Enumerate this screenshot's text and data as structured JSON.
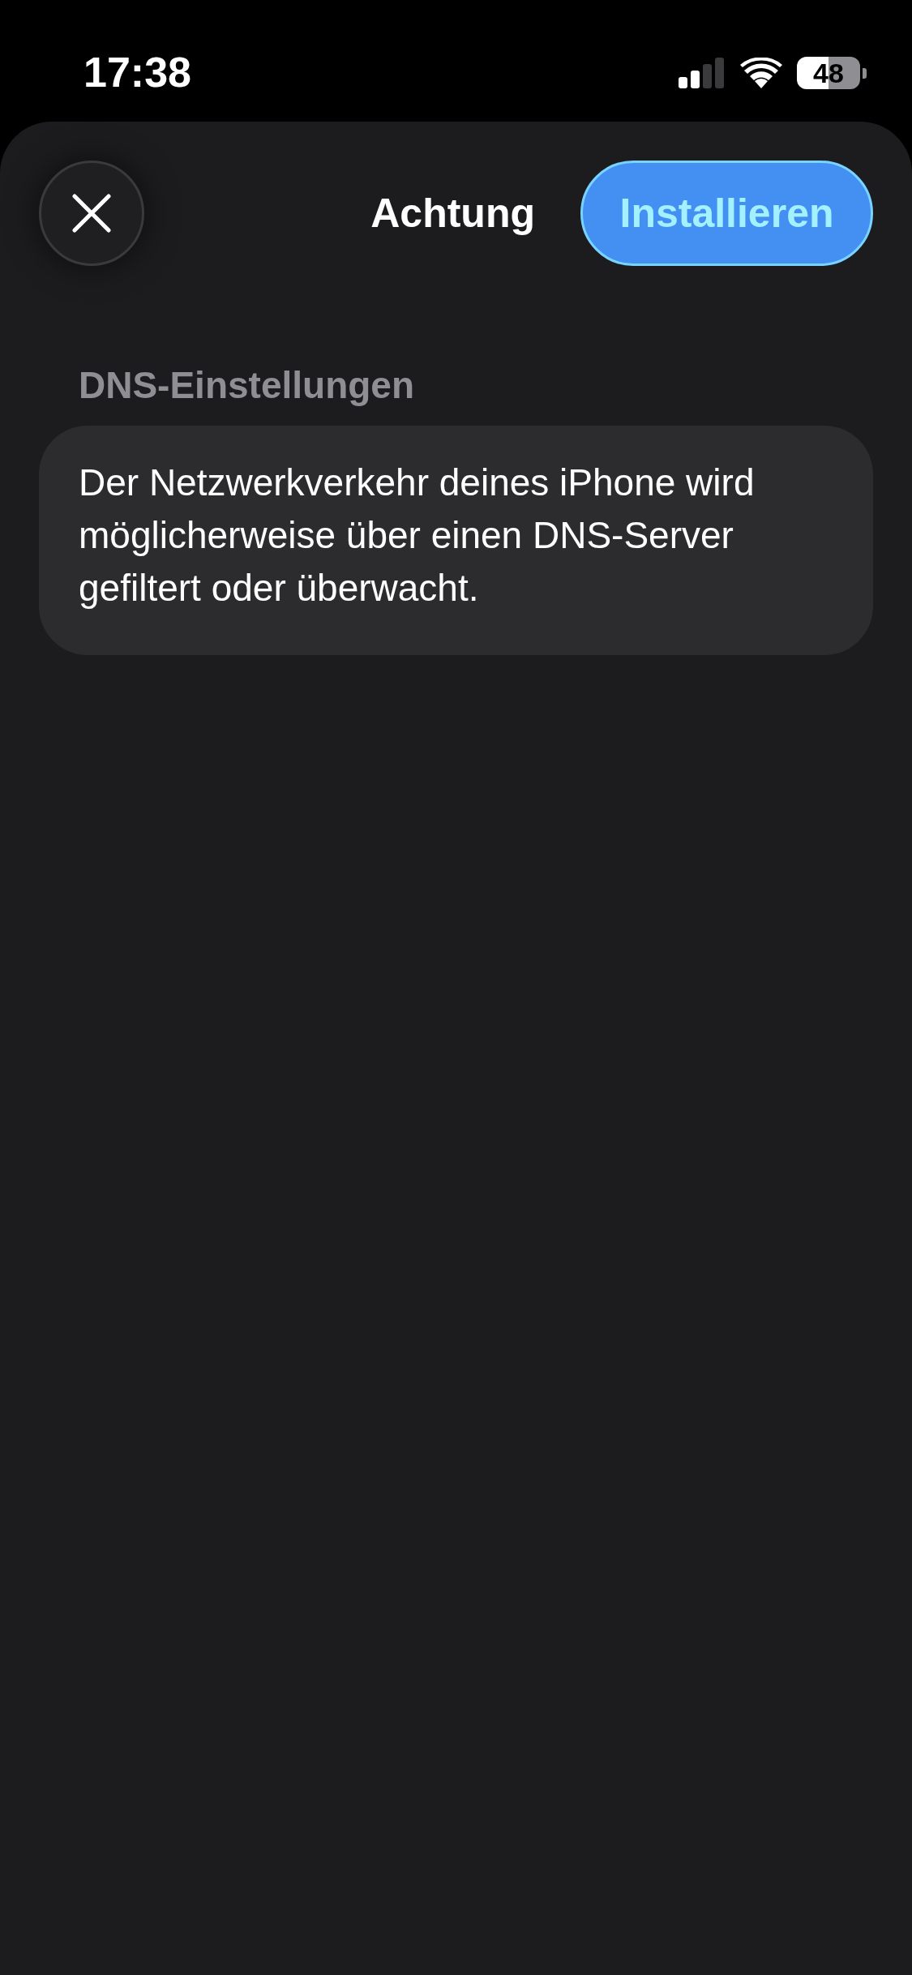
{
  "status_bar": {
    "time": "17:38",
    "battery": "48"
  },
  "sheet": {
    "title": "Achtung",
    "primary_button": {
      "label": "Installieren"
    }
  },
  "sections": [
    {
      "header": "DNS-Einstellungen",
      "text": "Der Netzwerkverkehr deines iPhone wird möglicherweise über einen DNS-Server gefiltert oder überwacht."
    }
  ]
}
